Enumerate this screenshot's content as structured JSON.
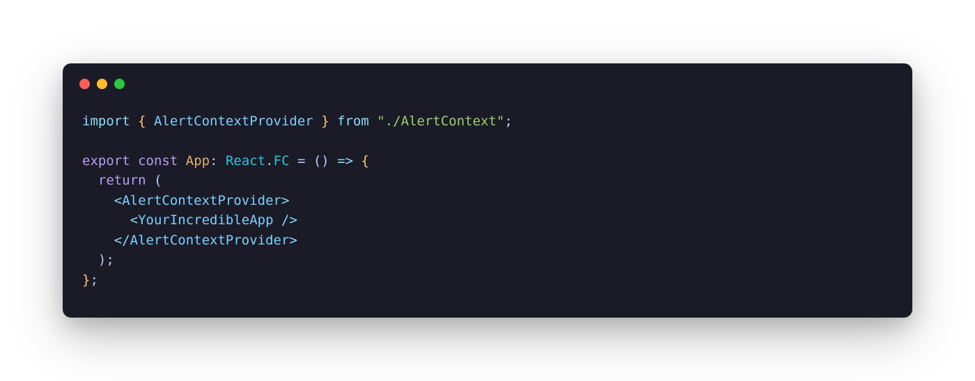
{
  "window": {
    "controls": {
      "close": "close",
      "minimize": "minimize",
      "maximize": "maximize"
    }
  },
  "code": {
    "line1": {
      "import": "import",
      "brace_open": " { ",
      "provider": "AlertContextProvider",
      "brace_close": " } ",
      "from": "from",
      "space": " ",
      "str_quote1": "\"",
      "path": "./AlertContext",
      "str_quote2": "\"",
      "semi": ";"
    },
    "line3": {
      "export": "export",
      "sp1": " ",
      "const": "const",
      "sp2": " ",
      "app": "App",
      "colon": ": ",
      "react": "React",
      "dot": ".",
      "fc": "FC",
      "eq": " = ",
      "paren_open": "(",
      "paren_close": ")",
      "sp3": " ",
      "arrow": "=>",
      "sp4": " ",
      "brace_open": "{"
    },
    "line4": {
      "indent": "  ",
      "return": "return",
      "sp": " ",
      "paren": "("
    },
    "line5": {
      "indent": "    ",
      "open": "<",
      "tag": "AlertContextProvider",
      "close": ">"
    },
    "line6": {
      "indent": "      ",
      "open": "<",
      "tag": "YourIncredibleApp",
      "sp": " ",
      "self": "/>"
    },
    "line7": {
      "indent": "    ",
      "open": "</",
      "tag": "AlertContextProvider",
      "close": ">"
    },
    "line8": {
      "indent": "  ",
      "paren": ")",
      "semi": ";"
    },
    "line9": {
      "brace": "}",
      "semi": ";"
    }
  }
}
